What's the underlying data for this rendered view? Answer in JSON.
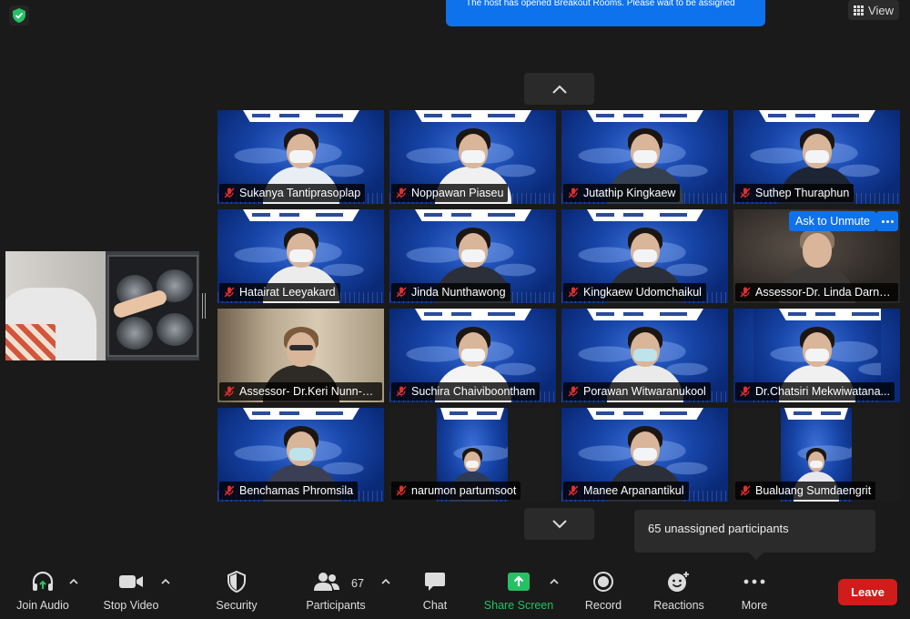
{
  "banner": {
    "text": "The host has opened Breakout Rooms. Please wait to be assigned"
  },
  "view_button": {
    "label": "View"
  },
  "tiles": [
    {
      "name": "Sukanya Tantiprasoplap"
    },
    {
      "name": "Noppawan Piaseu"
    },
    {
      "name": "Jutathip Kingkaew"
    },
    {
      "name": "Suthep Thuraphun"
    },
    {
      "name": "Hatairat Leeyakard"
    },
    {
      "name": "Jinda Nunthawong"
    },
    {
      "name": "Kingkaew Udomchaikul"
    },
    {
      "name": "Assessor-Dr. Linda Darnel..."
    },
    {
      "name": "Assessor- Dr.Keri Nunn-El..."
    },
    {
      "name": "Suchira Chaiviboontham"
    },
    {
      "name": "Porawan Witwaranukool"
    },
    {
      "name": "Dr.Chatsiri Mekwiwatana..."
    },
    {
      "name": "Benchamas Phromsila"
    },
    {
      "name": "narumon partumsoot"
    },
    {
      "name": "Manee Arpanantikul"
    },
    {
      "name": "Bualuang Sumdaengrit"
    }
  ],
  "ask_to_unmute": {
    "label": "Ask to Unmute"
  },
  "tooltip": {
    "text": "65 unassigned participants"
  },
  "toolbar": {
    "join_audio": "Join Audio",
    "stop_video": "Stop Video",
    "security": "Security",
    "participants": "Participants",
    "participants_count": "67",
    "chat": "Chat",
    "share_screen": "Share Screen",
    "record": "Record",
    "reactions": "Reactions",
    "more": "More",
    "leave": "Leave"
  },
  "colors": {
    "accent": "#0e72ed",
    "leave": "#d21b1b",
    "share": "#26c064",
    "background": "#1a1a1a"
  },
  "icons": [
    "shield-check-icon",
    "grid-icon",
    "chevron-up-icon",
    "chevron-down-icon",
    "mic-muted-icon",
    "headphones-icon",
    "camera-icon",
    "shield-icon",
    "participants-icon",
    "chat-icon",
    "share-screen-icon",
    "record-icon",
    "reactions-icon",
    "more-icon"
  ]
}
